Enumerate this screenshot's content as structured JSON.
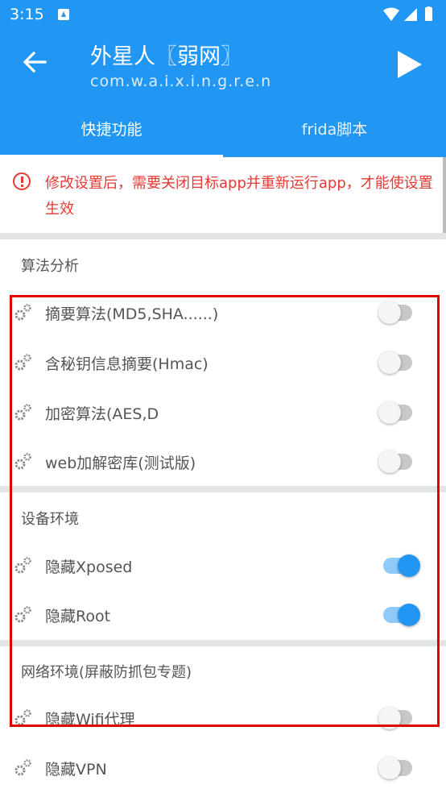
{
  "status_bar": {
    "time": "3:15"
  },
  "header": {
    "title": "外星人〖弱网〗",
    "subtitle": "com.w.a.i.x.i.n.g.r.e.n",
    "tabs": [
      {
        "label": "快捷功能"
      },
      {
        "label": "frida脚本"
      }
    ]
  },
  "warning": {
    "text": "修改设置后，需要关闭目标app并重新运行app，才能使设置生效"
  },
  "sections": [
    {
      "title": "算法分析",
      "items": [
        {
          "label": "摘要算法(MD5,SHA......)",
          "enabled": false
        },
        {
          "label": "含秘钥信息摘要(Hmac)",
          "enabled": false
        },
        {
          "label": "加密算法(AES,D",
          "enabled": false
        },
        {
          "label": "web加解密库(测试版)",
          "enabled": false
        }
      ]
    },
    {
      "title": "设备环境",
      "items": [
        {
          "label": "隐藏Xposed",
          "enabled": true
        },
        {
          "label": "隐藏Root",
          "enabled": true
        }
      ]
    },
    {
      "title": "网络环境(屏蔽防抓包专题)",
      "items": [
        {
          "label": "隐藏Wifi代理",
          "enabled": false
        },
        {
          "label": "隐藏VPN",
          "enabled": false
        }
      ]
    }
  ],
  "colors": {
    "primary": "#2196f3",
    "warning": "#e53935",
    "highlight": "#e00000"
  }
}
